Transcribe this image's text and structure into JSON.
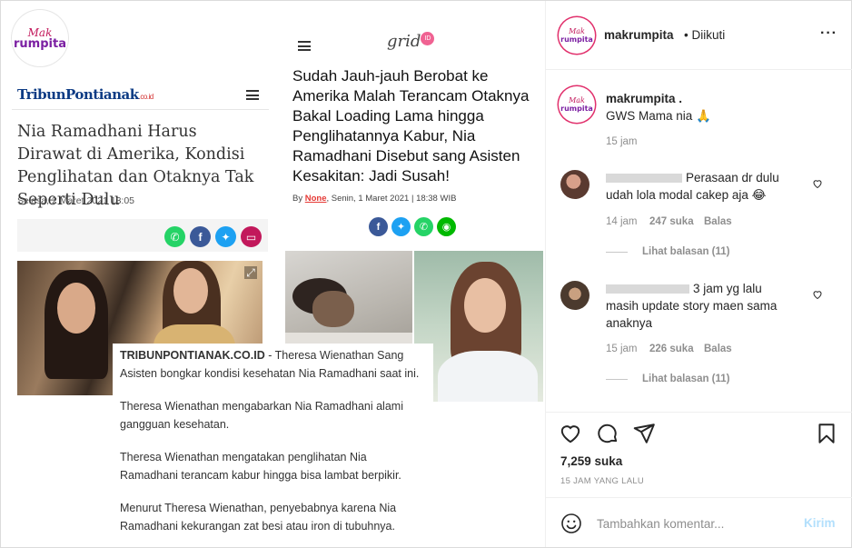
{
  "post": {
    "brand_logo": {
      "line1": "Mak",
      "line2": "rumpita"
    },
    "tribun": {
      "logo_main": "TribunPontianak",
      "logo_tld": ".co.id",
      "title": "Nia Ramadhani Harus Dirawat di Amerika, Kondisi Penglihatan dan Otaknya Tak Seperti Dulu",
      "date": "Selasa, 2 Maret 2021 13:05",
      "caption_source": "TRIBUNPONTIANAK.CO.ID",
      "caption_rest": " - Theresa Wienathan Sang Asisten bongkar kondisi kesehatan Nia Ramadhani saat ini.",
      "paragraphs": [
        "Theresa Wienathan mengabarkan Nia Ramadhani alami gangguan kesehatan.",
        "Theresa Wienathan mengatakan penglihatan Nia Ramadhani terancam kabur hingga bisa lambat berpikir.",
        "Menurut Theresa Wienathan, penyebabnya karena Nia Ramadhani kekurangan zat besi atau iron di tubuhnya."
      ]
    },
    "grid": {
      "logo": "grid",
      "logo_badge": "ID",
      "title": "Sudah Jauh-jauh Berobat ke Amerika Malah Terancam Otaknya Bakal Loading Lama hingga Penglihatannya Kabur, Nia Ramadhani Disebut sang Asisten Kesakitan: Jadi Susah!",
      "byline_prefix": "By ",
      "byline_author": "None",
      "byline_rest": ", Senin, 1 Maret 2021 | 18:38 WIB"
    }
  },
  "panel": {
    "header": {
      "username": "makrumpita",
      "follow_status": "• Diikuti"
    },
    "caption": {
      "username": "makrumpita .",
      "text": "GWS Mama nia 🙏",
      "time": "15 jam"
    },
    "comments": [
      {
        "text_a": "Perasaan dr dulu",
        "text_b": "udah lola modal cakep aja 😂",
        "time": "14 jam",
        "likes": "247 suka",
        "reply": "Balas",
        "view_replies": "Lihat balasan (11)"
      },
      {
        "text_a": "3 jam yg lalu",
        "text_b": "masih update story maen sama",
        "text_c": "anaknya",
        "time": "15 jam",
        "likes": "226 suka",
        "reply": "Balas",
        "view_replies": "Lihat balasan (11)"
      }
    ],
    "likes_count": "7,259 suka",
    "time_ago": "15 JAM YANG LALU",
    "add_comment_placeholder": "Tambahkan komentar...",
    "post_button": "Kirim"
  },
  "colors": {
    "accent": "#0095f6",
    "post_disabled": "#b2dffc",
    "muted": "#8e8e8e",
    "story_ring": "#e1306c"
  }
}
